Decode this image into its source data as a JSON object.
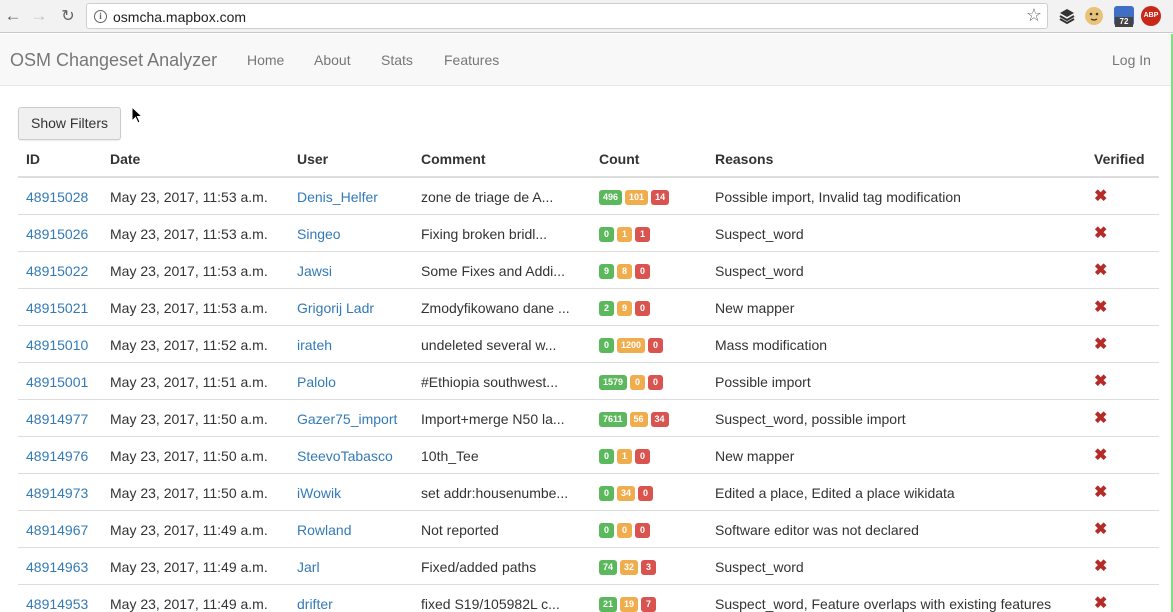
{
  "browser": {
    "url": "osmcha.mapbox.com",
    "ext_badge": "72",
    "abp_label": "ABP"
  },
  "navbar": {
    "brand": "OSM Changeset Analyzer",
    "links": [
      "Home",
      "About",
      "Stats",
      "Features"
    ],
    "login": "Log In"
  },
  "filters": {
    "show_label": "Show Filters"
  },
  "table": {
    "headers": [
      "ID",
      "Date",
      "User",
      "Comment",
      "Count",
      "Reasons",
      "Verified"
    ],
    "rows": [
      {
        "id": "48915028",
        "date": "May 23, 2017, 11:53 a.m.",
        "user": "Denis_Helfer",
        "comment": "zone de triage de A...",
        "count": [
          "496",
          "101",
          "14"
        ],
        "reasons": "Possible import, Invalid tag modification",
        "verified": "✖"
      },
      {
        "id": "48915026",
        "date": "May 23, 2017, 11:53 a.m.",
        "user": "Singeo",
        "comment": "Fixing broken bridl...",
        "count": [
          "0",
          "1",
          "1"
        ],
        "reasons": "Suspect_word",
        "verified": "✖"
      },
      {
        "id": "48915022",
        "date": "May 23, 2017, 11:53 a.m.",
        "user": "Jawsi",
        "comment": "Some Fixes and Addi...",
        "count": [
          "9",
          "8",
          "0"
        ],
        "reasons": "Suspect_word",
        "verified": "✖"
      },
      {
        "id": "48915021",
        "date": "May 23, 2017, 11:53 a.m.",
        "user": "Grigorij Ladr",
        "comment": "Zmodyfikowano dane ...",
        "count": [
          "2",
          "9",
          "0"
        ],
        "reasons": "New mapper",
        "verified": "✖"
      },
      {
        "id": "48915010",
        "date": "May 23, 2017, 11:52 a.m.",
        "user": "irateh",
        "comment": "undeleted several w...",
        "count": [
          "0",
          "1200",
          "0"
        ],
        "reasons": "Mass modification",
        "verified": "✖"
      },
      {
        "id": "48915001",
        "date": "May 23, 2017, 11:51 a.m.",
        "user": "Palolo",
        "comment": "#Ethiopia southwest...",
        "count": [
          "1579",
          "0",
          "0"
        ],
        "reasons": "Possible import",
        "verified": "✖"
      },
      {
        "id": "48914977",
        "date": "May 23, 2017, 11:50 a.m.",
        "user": "Gazer75_import",
        "comment": "Import+merge N50 la...",
        "count": [
          "7611",
          "56",
          "34"
        ],
        "reasons": "Suspect_word, possible import",
        "verified": "✖"
      },
      {
        "id": "48914976",
        "date": "May 23, 2017, 11:50 a.m.",
        "user": "SteevoTabasco",
        "comment": "10th_Tee",
        "count": [
          "0",
          "1",
          "0"
        ],
        "reasons": "New mapper",
        "verified": "✖"
      },
      {
        "id": "48914973",
        "date": "May 23, 2017, 11:50 a.m.",
        "user": "iWowik",
        "comment": "set addr:housenumbe...",
        "count": [
          "0",
          "34",
          "0"
        ],
        "reasons": "Edited a place, Edited a place wikidata",
        "verified": "✖"
      },
      {
        "id": "48914967",
        "date": "May 23, 2017, 11:49 a.m.",
        "user": "Rowland",
        "comment": "Not reported",
        "count": [
          "0",
          "0",
          "0"
        ],
        "reasons": "Software editor was not declared",
        "verified": "✖"
      },
      {
        "id": "48914963",
        "date": "May 23, 2017, 11:49 a.m.",
        "user": "Jarl",
        "comment": "Fixed/added paths",
        "count": [
          "74",
          "32",
          "3"
        ],
        "reasons": "Suspect_word",
        "verified": "✖"
      },
      {
        "id": "48914953",
        "date": "May 23, 2017, 11:49 a.m.",
        "user": "drifter",
        "comment": "fixed S19/105982L c...",
        "count": [
          "21",
          "19",
          "7"
        ],
        "reasons": "Suspect_word, Feature overlaps with existing features",
        "verified": "✖"
      }
    ]
  },
  "colors": {
    "create": "#5cb85c",
    "modify": "#f0ad4e",
    "delete": "#d9534f",
    "link": "#337ab7",
    "unverified": "#b52b27"
  }
}
